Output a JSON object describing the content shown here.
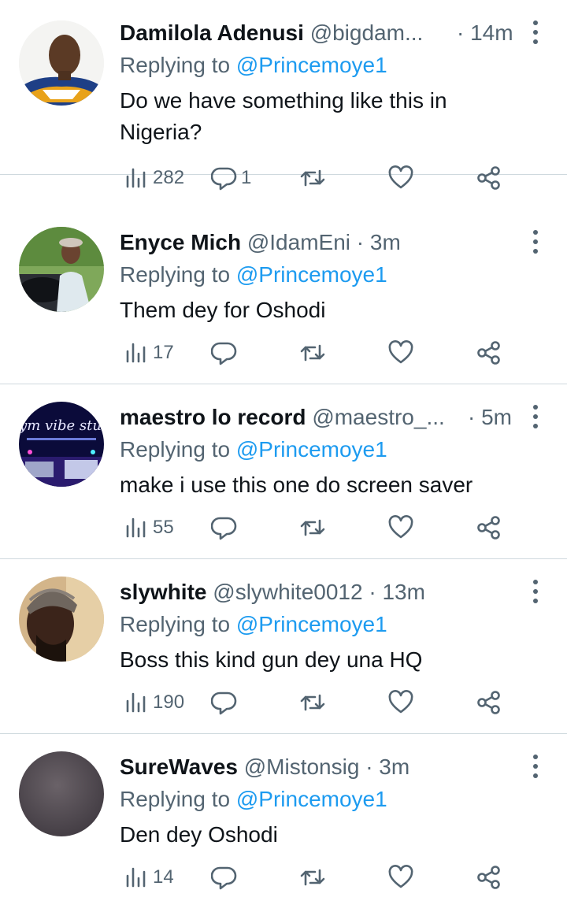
{
  "tweets": [
    {
      "name": "Damilola Adenusi",
      "handle": "@bigdam...",
      "time": "14m",
      "reply_prefix": "Replying to",
      "reply_to": "@Princemoye1",
      "text": "Do we have something like this in Nigeria?",
      "views": "282",
      "replies": "1"
    },
    {
      "name": "Enyce Mich",
      "handle": "@IdamEni",
      "time": "3m",
      "reply_prefix": "Replying to",
      "reply_to": "@Princemoye1",
      "text": "Them dey for Oshodi",
      "views": "17",
      "replies": ""
    },
    {
      "name": "maestro lo record",
      "handle": "@maestro_...",
      "time": "5m",
      "reply_prefix": "Replying to",
      "reply_to": "@Princemoye1",
      "text": "make i use this one do screen saver",
      "views": "55",
      "replies": "",
      "avatar_logo": "Rhym vibe studio"
    },
    {
      "name": "slywhite",
      "handle": "@slywhite0012",
      "time": "13m",
      "reply_prefix": "Replying to",
      "reply_to": "@Princemoye1",
      "text": "Boss this kind gun dey una HQ",
      "views": "190",
      "replies": ""
    },
    {
      "name": "SureWaves",
      "handle": "@Mistonsig",
      "time": "3m",
      "reply_prefix": "Replying to",
      "reply_to": "@Princemoye1",
      "text": "Den dey Oshodi",
      "views": "14",
      "replies": ""
    }
  ],
  "separator": "·",
  "icons": {
    "views": "bar-chart-icon",
    "reply": "speech-bubble-icon",
    "retweet": "retweet-arrows-icon",
    "like": "heart-icon",
    "share": "share-nodes-icon",
    "more": "vertical-dots-icon"
  },
  "colors": {
    "text": "#0f1419",
    "secondary": "#536471",
    "link": "#1d9bf0",
    "divider": "#cfd9de"
  }
}
